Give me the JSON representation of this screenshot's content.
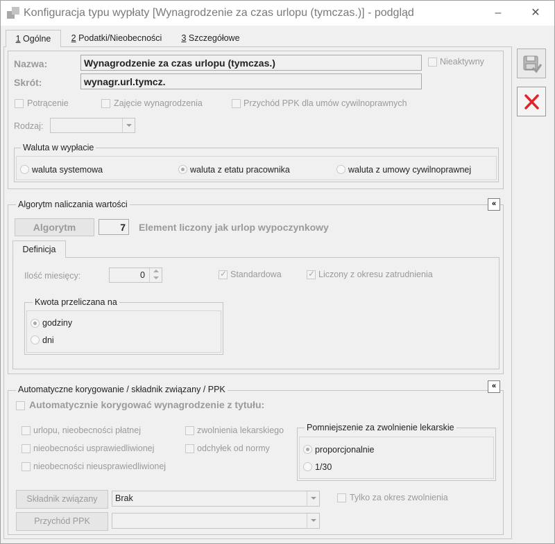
{
  "window": {
    "title": "Konfiguracja typu wypłaty [Wynagrodzenie za czas urlopu (tymczas.)] - podgląd",
    "minimize_symbol": "–",
    "close_symbol": "✕"
  },
  "tabs": [
    {
      "hotkey": "1",
      "label": " Ogólne"
    },
    {
      "hotkey": "2",
      "label": " Podatki/Nieobecności"
    },
    {
      "hotkey": "3",
      "label": " Szczegółowe"
    }
  ],
  "general": {
    "name_label": "Nazwa:",
    "name_value": "Wynagrodzenie za czas urlopu (tymczas.)",
    "short_label": "Skrót:",
    "short_value": "wynagr.url.tymcz.",
    "inactive_label": "Nieaktywny",
    "deduction_label": "Potrącenie",
    "garnishment_label": "Zajęcie wynagrodzenia",
    "ppk_income_label": "Przychód PPK dla umów cywilnoprawnych",
    "type_label": "Rodzaj:",
    "type_value": ""
  },
  "currency": {
    "title": "Waluta w wypłacie",
    "options": [
      "waluta systemowa",
      "waluta z etatu pracownika",
      "waluta z umowy cywilnoprawnej"
    ],
    "selected": "waluta z etatu pracownika"
  },
  "algorithm": {
    "section_title": "Algorytm naliczania wartości",
    "collapse_symbol": "«",
    "button_label": "Algorytm",
    "number": "7",
    "description": "Element liczony jak urlop wypoczynkowy",
    "subtab": "Definicja",
    "months_label": "Ilość miesięcy:",
    "months_value": "0",
    "standard_label": "Standardowa",
    "employment_period_label": "Liczony z okresu zatrudnienia",
    "amount_group_title": "Kwota przeliczana na",
    "amount_options": [
      "godziny",
      "dni"
    ],
    "amount_selected": "godziny"
  },
  "correction": {
    "section_title": "Automatyczne korygowanie / składnik związany / PPK",
    "collapse_symbol": "«",
    "auto_label": "Automatycznie korygować wynagrodzenie z tytułu:",
    "items": [
      "urlopu, nieobecności płatnej",
      "nieobecności usprawiedliwionej",
      "nieobecności nieusprawiedliwionej",
      "zwolnienia lekarskiego",
      "odchyłek od normy"
    ],
    "reduction_title": "Pomniejszenie za zwolnienie lekarskie",
    "reduction_options": [
      "proporcjonalnie",
      "1/30"
    ],
    "reduction_selected": "proporcjonalnie",
    "related_button": "Składnik związany",
    "related_value": "Brak",
    "only_sick_label": "Tylko za okres zwolnienia",
    "ppk_button": "Przychód PPK",
    "ppk_value": ""
  },
  "sidebar": {
    "save_icon": "save-icon",
    "close_icon": "cancel-x-icon",
    "close_color": "#e0242b"
  }
}
